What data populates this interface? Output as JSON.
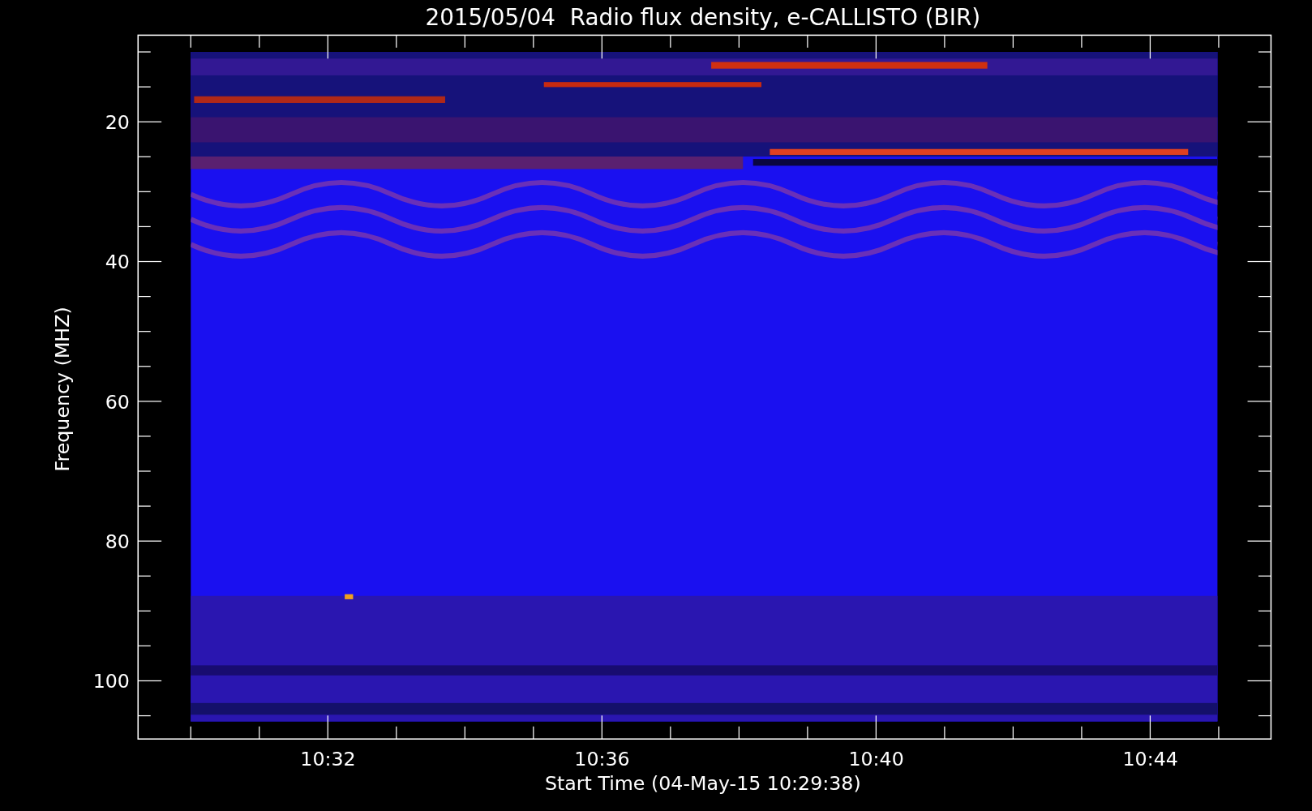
{
  "plot": {
    "title": "2015/05/04  Radio flux density, e-CALLISTO (BIR)",
    "ylabel": "Frequency (MHZ)",
    "yticks": [
      "20",
      "40",
      "60",
      "80",
      "100"
    ],
    "xticks": [
      "10:32",
      "10:36",
      "10:40",
      "10:44"
    ],
    "xlabel": "Start Time (04-May-15 10:29:38)"
  }
}
